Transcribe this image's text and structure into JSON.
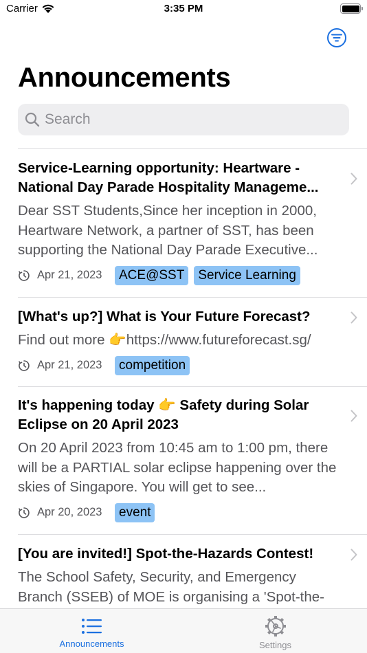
{
  "status_bar": {
    "carrier": "Carrier",
    "time": "3:35 PM"
  },
  "page": {
    "title": "Announcements"
  },
  "search": {
    "placeholder": "Search"
  },
  "announcements": [
    {
      "title": "Service-Learning opportunity: Heartware - National Day Parade Hospitality Manageme...",
      "snippet": "Dear SST Students,Since her inception in 2000, Heartware Network, a partner of SST, has been supporting the National Day Parade Executive...",
      "date": "Apr 21, 2023",
      "tags": [
        "ACE@SST",
        "Service Learning"
      ]
    },
    {
      "title": "[What's up?]  What is Your Future Forecast?",
      "snippet": "Find out more 👉https://www.futureforecast.sg/",
      "date": "Apr 21, 2023",
      "tags": [
        "competition"
      ]
    },
    {
      "title": "It's happening today 👉 Safety during Solar Eclipse on 20 April 2023",
      "snippet": "On 20 April 2023 from 10:45 am to 1:00 pm, there will be a PARTIAL solar eclipse happening over the skies of Singapore. You will get to see...",
      "date": "Apr 20, 2023",
      "tags": [
        "event"
      ]
    },
    {
      "title": "[You are invited!] Spot-the-Hazards Contest!",
      "snippet": "The School Safety, Security, and Emergency Branch (SSEB) of MOE is organising a 'Spot-the-",
      "date": "",
      "tags": []
    }
  ],
  "tab_bar": {
    "tabs": [
      {
        "label": "Announcements",
        "icon": "list-icon",
        "active": true
      },
      {
        "label": "Settings",
        "icon": "gear-icon",
        "active": false
      }
    ]
  },
  "colors": {
    "accent": "#1a6fe0",
    "tag_bg": "#8dc3f5",
    "secondary_text": "#555559"
  }
}
